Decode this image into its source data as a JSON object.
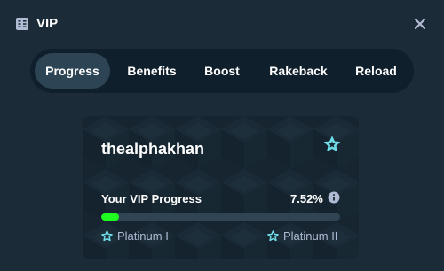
{
  "header": {
    "title": "VIP",
    "icon": "vip-ticket-icon",
    "close_icon": "close-icon"
  },
  "tabs": [
    {
      "label": "Progress",
      "active": true
    },
    {
      "label": "Benefits",
      "active": false
    },
    {
      "label": "Boost",
      "active": false
    },
    {
      "label": "Rakeback",
      "active": false
    },
    {
      "label": "Reload",
      "active": false
    }
  ],
  "card": {
    "username": "thealphakhan",
    "badge_icon": "star-icon",
    "progress_label": "Your VIP Progress",
    "progress_value": "7.52%",
    "progress_fraction": 0.0752,
    "info_icon": "info-icon",
    "current_tier": "Platinum I",
    "next_tier": "Platinum II"
  },
  "colors": {
    "background": "#1b2c38",
    "tabs_background": "#0f1f2b",
    "active_tab": "#2d4454",
    "progress_fill": "#1fff20",
    "progress_track": "#2f4553",
    "tier_text": "#b1bad3",
    "badge_star": "#6fdde7"
  }
}
